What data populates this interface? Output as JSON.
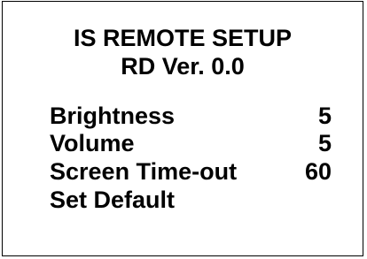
{
  "screen": {
    "title": "IS REMOTE SETUP",
    "version": "RD Ver. 0.0"
  },
  "menu": {
    "items": [
      {
        "label": "Brightness",
        "value": "5"
      },
      {
        "label": "Volume",
        "value": "5"
      },
      {
        "label": "Screen Time-out",
        "value": "60"
      },
      {
        "label": "Set Default",
        "value": ""
      }
    ]
  },
  "colors": {
    "background": "#ffffff",
    "text": "#000000",
    "border": "#000000"
  }
}
